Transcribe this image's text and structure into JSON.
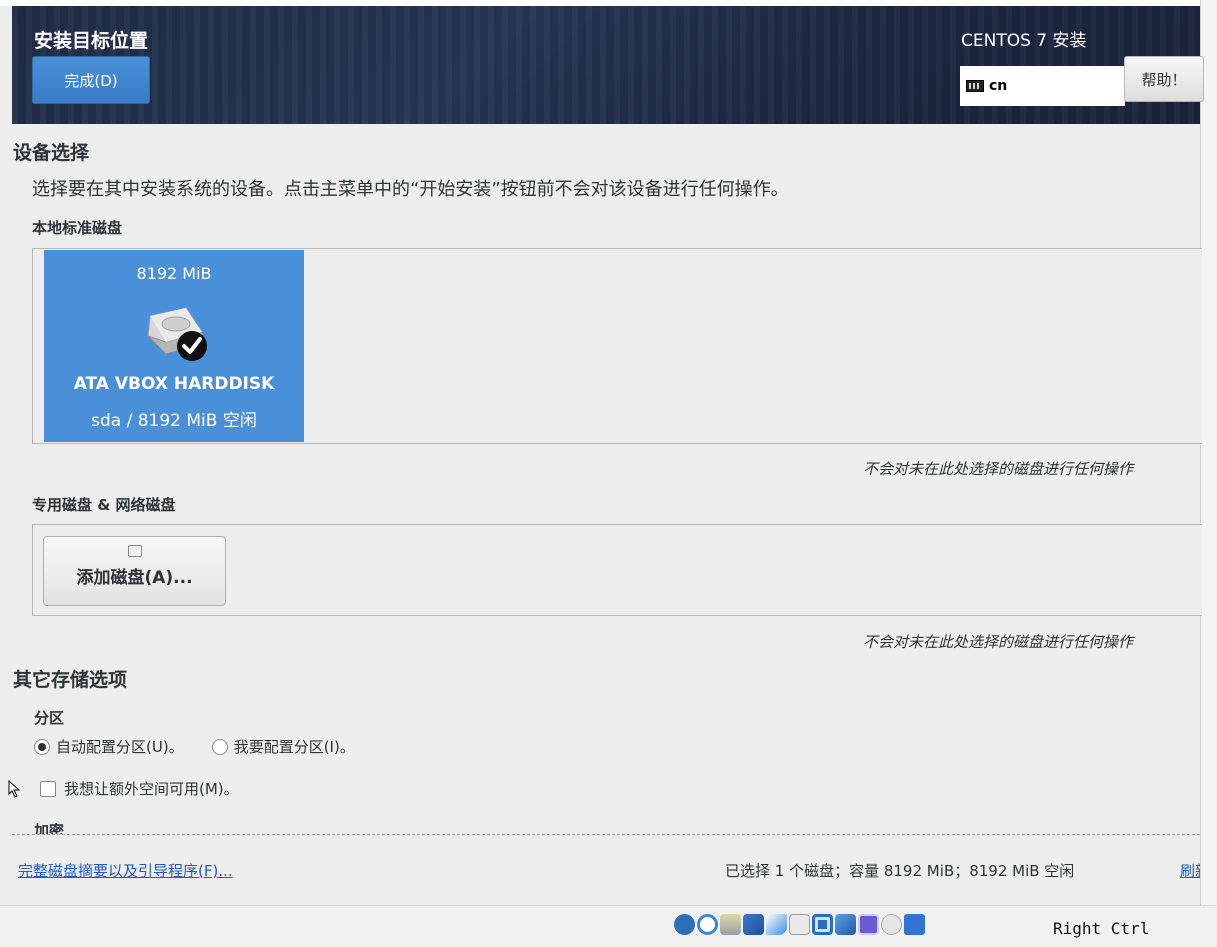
{
  "header": {
    "title": "安装目标位置",
    "done_label": "完成(D)",
    "product": "CENTOS 7 安装",
    "keyboard_layout": "cn",
    "help_label": "帮助！"
  },
  "device_selection": {
    "heading": "设备选择",
    "description": "选择要在其中安装系统的设备。点击主菜单中的“开始安装”按钮前不会对该设备进行任何操作。",
    "local_disks_heading": "本地标准磁盘",
    "disk": {
      "size": "8192 MiB",
      "name": "ATA VBOX HARDDISK",
      "info": "sda  /  8192 MiB 空闲",
      "selected": true
    },
    "local_note": "不会对未在此处选择的磁盘进行任何操作",
    "special_disks_heading": "专用磁盘 & 网络磁盘",
    "add_disk_label": "添加磁盘(A)...",
    "special_note": "不会对未在此处选择的磁盘进行任何操作"
  },
  "other_options": {
    "heading": "其它存储选项",
    "partition_heading": "分区",
    "auto_partition_label": "自动配置分区(U)。",
    "manual_partition_label": "我要配置分区(I)。",
    "auto_selected": true,
    "extra_space_label": "我想让额外空间可用(M)。",
    "encryption_heading": "加密"
  },
  "footer": {
    "summary_link": "完整磁盘摘要以及引导程序(F)...",
    "status": "已选择 1 个磁盘；容量 8192 MiB；8192 MiB 空闲",
    "refresh_link": "刷新"
  },
  "taskbar": {
    "host_key": "Right Ctrl",
    "icons": [
      "audio-icon",
      "optical-drive-icon",
      "network-adapter-icon",
      "network-icon",
      "usb-icon",
      "shared-folder-icon",
      "display-icon",
      "capture-icon",
      "vbox-icon",
      "mouse-integration-icon",
      "keyboard-capture-icon"
    ]
  },
  "colors": {
    "accent": "#4a90d9",
    "header_bg": "#1f2c45",
    "link": "#1f5bc6"
  }
}
